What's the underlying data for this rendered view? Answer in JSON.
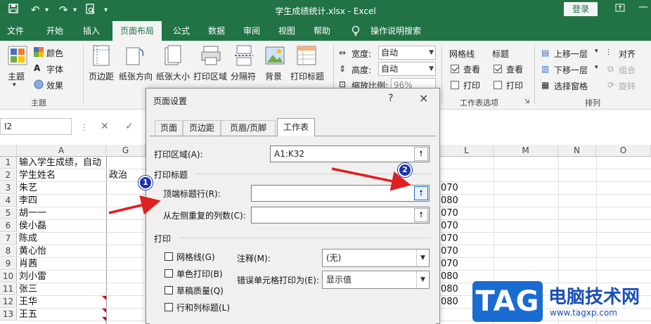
{
  "window": {
    "title": "学生成绩统计.xlsx  -  Excel",
    "login": "登录"
  },
  "ribbon_tabs": [
    "文件",
    "开始",
    "插入",
    "页面布局",
    "公式",
    "数据",
    "审阅",
    "视图",
    "帮助",
    "操作说明搜索"
  ],
  "ribbon": {
    "theme": {
      "main": "主题",
      "colors": "颜色",
      "fonts": "字体",
      "effects": "效果",
      "group": "主题"
    },
    "page_setup": {
      "margins": "页边距",
      "orientation": "纸张方向",
      "size": "纸张大小",
      "print_area": "打印区域",
      "breaks": "分隔符",
      "background": "背景",
      "print_titles": "打印标题"
    },
    "scale": {
      "width_label": "宽度:",
      "width_value": "自动",
      "height_label": "高度:",
      "height_value": "自动",
      "scale_label": "缩放比例:",
      "scale_value": "96%"
    },
    "sheet_options": {
      "gridlines": "网格线",
      "headings": "标题",
      "view": "查看",
      "print": "打印",
      "group": "工作表选项"
    },
    "arrange": {
      "bring_forward": "上移一层",
      "send_backward": "下移一层",
      "selection_pane": "选择窗格",
      "align": "对齐",
      "group_btn": "组合",
      "rotate": "旋转",
      "group": "排列"
    }
  },
  "formula_bar": {
    "name_box": "I2"
  },
  "grid": {
    "columns": [
      "A",
      "G",
      "L",
      "M",
      "N",
      "O"
    ],
    "rows": [
      "1",
      "2",
      "3",
      "4",
      "5",
      "6",
      "7",
      "8",
      "9",
      "10",
      "11",
      "12",
      "13"
    ],
    "a_cells": [
      "输入学生成绩，自动",
      "学生姓名",
      "朱艺",
      "李四",
      "胡一一",
      "侯小磊",
      "陈成",
      "黄心怡",
      "肖茜",
      "刘小雷",
      "张三",
      "王华",
      "王五"
    ],
    "g2": "政治",
    "k_partial": [
      "070",
      "080",
      "070",
      "070",
      "070",
      "070",
      "070",
      "080",
      "080",
      "080"
    ]
  },
  "dialog": {
    "title": "页面设置",
    "help": "?",
    "close": "×",
    "tabs": [
      "页面",
      "页边距",
      "页眉/页脚",
      "工作表"
    ],
    "print_area_label": "打印区域(A):",
    "print_area_value": "A1:K32",
    "print_titles_header": "打印标题",
    "rows_to_repeat_label": "顶端标题行(R):",
    "cols_to_repeat_label": "从左侧重复的列数(C):",
    "print_header": "打印",
    "checks": [
      "网格线(G)",
      "单色打印(B)",
      "草稿质量(Q)",
      "行和列标题(L)"
    ],
    "comments_label": "注释(M):",
    "comments_value": "(无)",
    "errors_label": "错误单元格打印为(E):",
    "errors_value": "显示值"
  },
  "annotations": {
    "badge1": "1",
    "badge2": "2",
    "arrow_color": "#e02020"
  },
  "watermark": {
    "tag": "TAG",
    "name": "电脑技术网",
    "url": "www.tagxp.com"
  },
  "colors": {
    "excel_green": "#217346",
    "badge_blue": "#1c33a8",
    "highlight_blue": "#1a6fc4"
  }
}
